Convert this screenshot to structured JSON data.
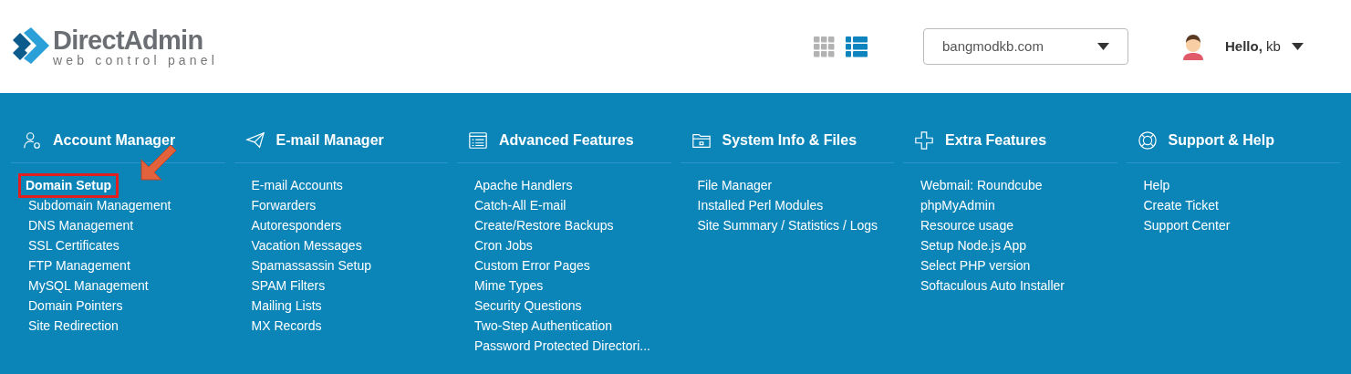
{
  "logo": {
    "name": "DirectAdmin",
    "tagline": "web control panel"
  },
  "view_toggle": [
    {
      "kind": "grid",
      "selected": false
    },
    {
      "kind": "list",
      "selected": true
    }
  ],
  "domain_select": {
    "value": "bangmodkb.com"
  },
  "user": {
    "greeting": "**Hello,** kb"
  },
  "sections": [
    {
      "kind": "account",
      "title": "Account Manager",
      "items": [
        {
          "label": "Domain Setup",
          "highlighted": true
        },
        {
          "label": "Subdomain Management",
          "highlighted": false
        },
        {
          "label": "DNS Management",
          "highlighted": false
        },
        {
          "label": "SSL Certificates",
          "highlighted": false
        },
        {
          "label": "FTP Management",
          "highlighted": false
        },
        {
          "label": "MySQL Management",
          "highlighted": false
        },
        {
          "label": "Domain Pointers",
          "highlighted": false
        },
        {
          "label": "Site Redirection",
          "highlighted": false
        }
      ]
    },
    {
      "kind": "email",
      "title": "E-mail Manager",
      "items": [
        {
          "label": "E-mail Accounts",
          "highlighted": false
        },
        {
          "label": "Forwarders",
          "highlighted": false
        },
        {
          "label": "Autoresponders",
          "highlighted": false
        },
        {
          "label": "Vacation Messages",
          "highlighted": false
        },
        {
          "label": "Spamassassin Setup",
          "highlighted": false
        },
        {
          "label": "SPAM Filters",
          "highlighted": false
        },
        {
          "label": "Mailing Lists",
          "highlighted": false
        },
        {
          "label": "MX Records",
          "highlighted": false
        }
      ]
    },
    {
      "kind": "advanced",
      "title": "Advanced Features",
      "items": [
        {
          "label": "Apache Handlers",
          "highlighted": false
        },
        {
          "label": "Catch-All E-mail",
          "highlighted": false
        },
        {
          "label": "Create/Restore Backups",
          "highlighted": false
        },
        {
          "label": "Cron Jobs",
          "highlighted": false
        },
        {
          "label": "Custom Error Pages",
          "highlighted": false
        },
        {
          "label": "Mime Types",
          "highlighted": false
        },
        {
          "label": "Security Questions",
          "highlighted": false
        },
        {
          "label": "Two-Step Authentication",
          "highlighted": false
        },
        {
          "label": "Password Protected Directori...",
          "highlighted": false
        }
      ]
    },
    {
      "kind": "system",
      "title": "System Info & Files",
      "items": [
        {
          "label": "File Manager",
          "highlighted": false
        },
        {
          "label": "Installed Perl Modules",
          "highlighted": false
        },
        {
          "label": "Site Summary / Statistics / Logs",
          "highlighted": false
        }
      ]
    },
    {
      "kind": "extra",
      "title": "Extra Features",
      "items": [
        {
          "label": "Webmail: Roundcube",
          "highlighted": false
        },
        {
          "label": "phpMyAdmin",
          "highlighted": false
        },
        {
          "label": "Resource usage",
          "highlighted": false
        },
        {
          "label": "Setup Node.js App",
          "highlighted": false
        },
        {
          "label": "Select PHP version",
          "highlighted": false
        },
        {
          "label": "Softaculous Auto Installer",
          "highlighted": false
        }
      ]
    },
    {
      "kind": "support",
      "title": "Support & Help",
      "items": [
        {
          "label": "Help",
          "highlighted": false
        },
        {
          "label": "Create Ticket",
          "highlighted": false
        },
        {
          "label": "Support Center",
          "highlighted": false
        }
      ]
    }
  ]
}
